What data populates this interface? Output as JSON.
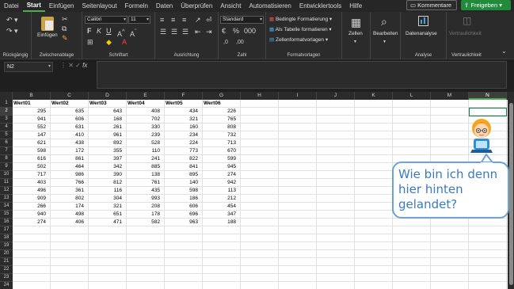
{
  "menu": {
    "tabs": [
      "Datei",
      "Start",
      "Einfügen",
      "Seitenlayout",
      "Formeln",
      "Daten",
      "Überprüfen",
      "Ansicht",
      "Automatisieren",
      "Entwicklertools",
      "Hilfe"
    ],
    "kommentare": "Kommentare",
    "freigeben": "Freigeben"
  },
  "ribbon": {
    "groups": {
      "undo": "Rückgängig",
      "clipboard": "Zwischenablage",
      "font": "Schriftart",
      "alignment": "Ausrichtung",
      "number": "Zahl",
      "styles": "Formatvorlagen",
      "analysis": "Analyse",
      "confidentiality": "Vertraulichkeit"
    },
    "paste_label": "Einfügen",
    "font_name": "Calibri",
    "font_size": "11",
    "number_format": "Standard",
    "conditional_format": "Bedingte Formatierung",
    "format_as_table": "Als Tabelle formatieren",
    "cell_styles": "Zellenformatvorlagen",
    "cells": "Zellen",
    "editing": "Bearbeiten",
    "data_analysis": "Datenanalyse",
    "sensitivity": "Vertraulichkeit"
  },
  "formula_bar": {
    "name_box": "N2",
    "fx": "fx",
    "value": ""
  },
  "grid": {
    "columns": [
      "B",
      "C",
      "D",
      "E",
      "F",
      "G",
      "H",
      "I",
      "J",
      "K",
      "L",
      "M",
      "N"
    ],
    "selected_column": "N",
    "rows": [
      "1",
      "2",
      "3",
      "4",
      "5",
      "6",
      "7",
      "8",
      "9",
      "10",
      "11",
      "12",
      "13",
      "14",
      "15",
      "16",
      "17",
      "18",
      "19",
      "20",
      "21",
      "22",
      "23",
      "24"
    ],
    "selected_row": "2",
    "headers": [
      "Wert01",
      "Wert02",
      "Wert03",
      "Wert04",
      "Wert05",
      "Wert06"
    ],
    "data": [
      [
        295,
        635,
        643,
        408,
        434,
        226
      ],
      [
        941,
        606,
        168,
        702,
        321,
        765
      ],
      [
        552,
        631,
        261,
        330,
        160,
        808
      ],
      [
        147,
        410,
        961,
        239,
        234,
        732
      ],
      [
        621,
        438,
        892,
        528,
        224,
        713
      ],
      [
        598,
        172,
        355,
        110,
        773,
        670
      ],
      [
        616,
        861,
        397,
        241,
        822,
        599
      ],
      [
        502,
        464,
        342,
        885,
        841,
        945
      ],
      [
        717,
        986,
        390,
        138,
        895,
        274
      ],
      [
        403,
        766,
        812,
        761,
        140,
        942
      ],
      [
        496,
        361,
        116,
        435,
        598,
        113
      ],
      [
        909,
        802,
        304,
        993,
        186,
        212
      ],
      [
        266,
        174,
        321,
        208,
        606,
        454
      ],
      [
        940,
        498,
        651,
        178,
        696,
        347
      ],
      [
        274,
        406,
        471,
        582,
        963,
        188
      ]
    ]
  },
  "overlay": {
    "bubble_text": "Wie bin ich denn\nhier hinten\ngelandet?"
  },
  "colors": {
    "accent_green": "#107c41",
    "share_button": "#218a3b",
    "bubble_border": "#6ba2d6",
    "bubble_text": "#3a7abf"
  }
}
